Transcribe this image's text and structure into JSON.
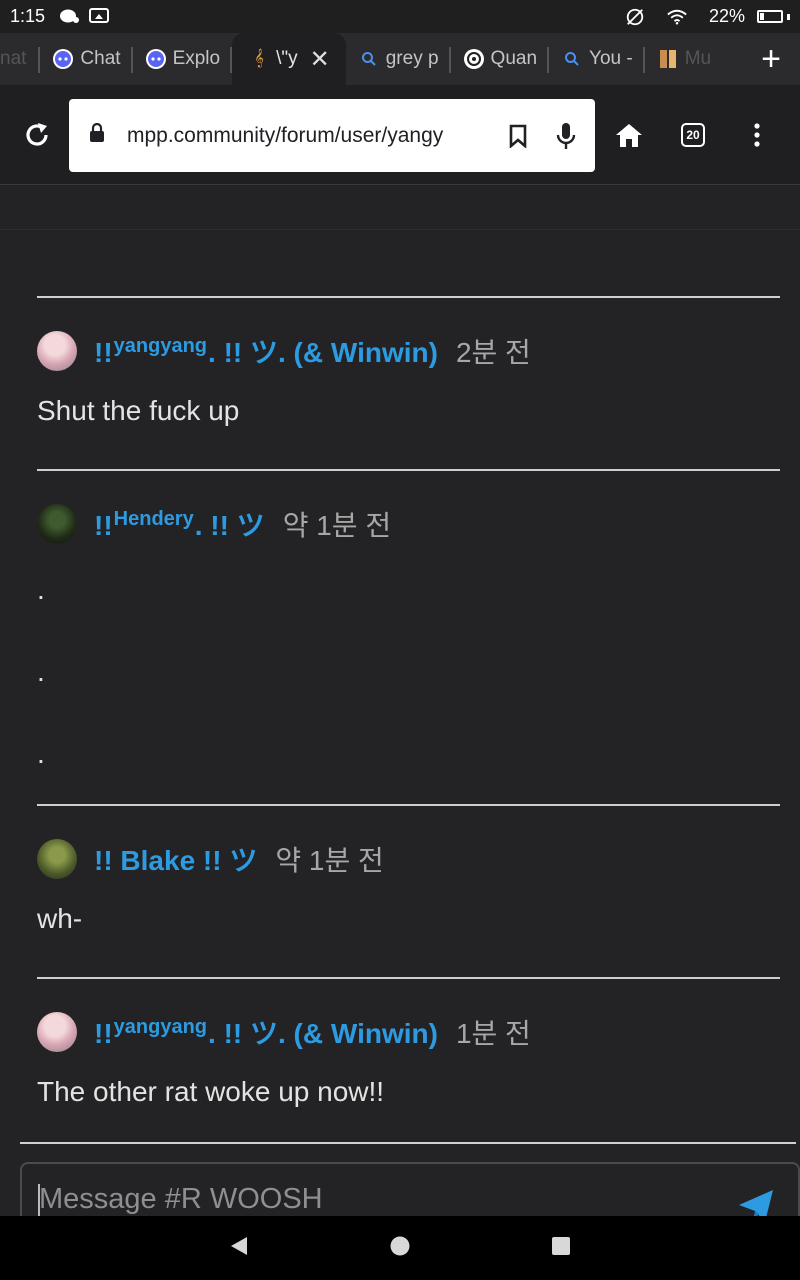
{
  "status_bar": {
    "time": "1:15",
    "battery": "22%",
    "battery_level": 0.22
  },
  "tabs": [
    {
      "label": "Chat",
      "icon": "discord-icon"
    },
    {
      "label": "Explo",
      "icon": "discord-icon"
    },
    {
      "label": "\\\"y",
      "icon": "music-note-icon",
      "active": true
    },
    {
      "label": "grey p",
      "icon": "search-icon"
    },
    {
      "label": "Quan",
      "icon": "chatgpt-icon"
    },
    {
      "label": "You -",
      "icon": "search-icon"
    },
    {
      "label": "Mu",
      "icon": "app-icon"
    }
  ],
  "toolbar": {
    "url": "mpp.community/forum/user/yangy",
    "tab_count": "20"
  },
  "messages": [
    {
      "name_pre": "!! ",
      "name_sup": "yangyang",
      "name_post": ". !! ツ. (& Winwin)",
      "time": "2분 전",
      "lines": [
        "Shut the fuck up"
      ]
    },
    {
      "name_pre": "!! ",
      "name_sup": "Hendery",
      "name_post": ". !! ツ",
      "time": "약 1분 전",
      "lines": [
        ".",
        ".",
        "."
      ]
    },
    {
      "name_pre": "!! Blake !! ツ",
      "name_sup": "",
      "name_post": "",
      "time": "약 1분 전",
      "lines": [
        "wh-"
      ]
    },
    {
      "name_pre": "!! ",
      "name_sup": "yangyang",
      "name_post": ". !! ツ. (& Winwin)",
      "time": "1분 전",
      "lines": [
        "The other rat woke up now!!"
      ]
    }
  ],
  "composer": {
    "placeholder": "Message #R WOOSH"
  },
  "colors": {
    "accent": "#2d9be2",
    "send": "#2d9be2"
  }
}
